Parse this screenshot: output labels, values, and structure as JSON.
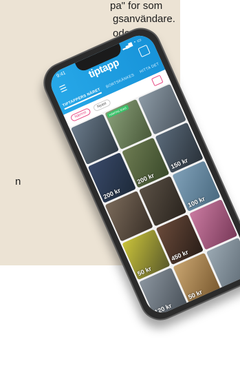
{
  "background_text": {
    "line1": "pa\" for som",
    "line2": "gsanvändare.",
    "line3": "oden",
    "line4": "n"
  },
  "app": {
    "status_time": "9:41",
    "logo": "tiptapp",
    "tabs": [
      "TIPTAPPERS NÄRET",
      "BORTSKÄNKES",
      "HITTA DET"
    ],
    "filters": [
      "Närmst",
      "Nyast"
    ],
    "tiles": [
      {
        "badge": "",
        "price": ""
      },
      {
        "badge": "HÄMTAS IDAG",
        "price": ""
      },
      {
        "badge": "",
        "price": ""
      },
      {
        "badge": "",
        "price": "200 kr"
      },
      {
        "badge": "",
        "price": "200 kr"
      },
      {
        "badge": "",
        "price": "150 kr"
      },
      {
        "badge": "",
        "price": ""
      },
      {
        "badge": "",
        "price": ""
      },
      {
        "badge": "",
        "price": "100 kr"
      },
      {
        "badge": "",
        "price": "50 kr"
      },
      {
        "badge": "",
        "price": "450 kr"
      },
      {
        "badge": "",
        "price": ""
      },
      {
        "badge": "",
        "price": "120 kr"
      },
      {
        "badge": "",
        "price": "50 kr"
      },
      {
        "badge": "",
        "price": ""
      }
    ]
  }
}
